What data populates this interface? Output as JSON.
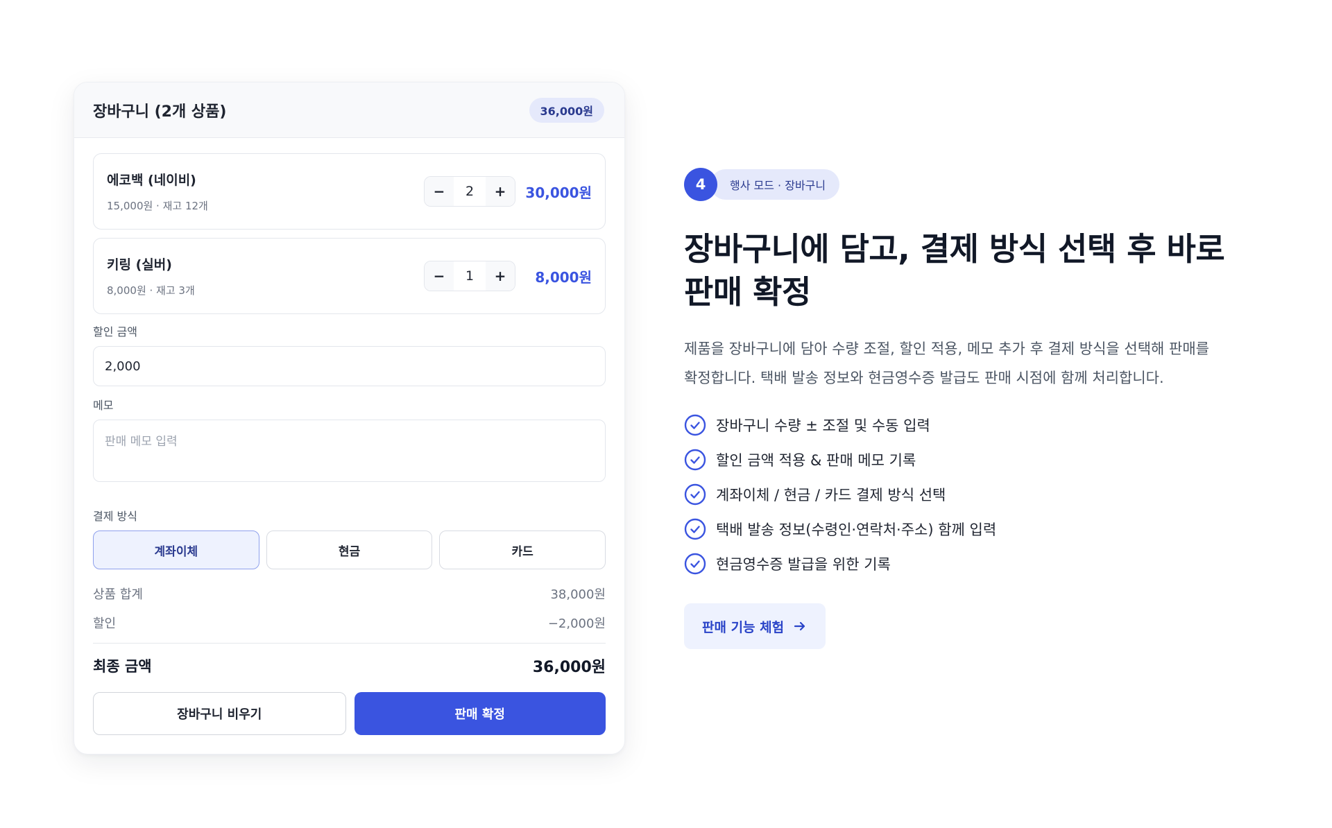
{
  "cart": {
    "title": "장바구니 (2개 상품)",
    "total_badge": "36,000원",
    "items": [
      {
        "name": "에코백 (네이비)",
        "meta": "15,000원 · 재고 12개",
        "quantity": "2",
        "price": "30,000원"
      },
      {
        "name": "키링 (실버)",
        "meta": "8,000원 · 재고 3개",
        "quantity": "1",
        "price": "8,000원"
      }
    ],
    "stepper": {
      "minus": "−",
      "plus": "+"
    },
    "discount": {
      "label": "할인 금액",
      "value": "2,000"
    },
    "memo": {
      "label": "메모",
      "placeholder": "판매 메모 입력"
    },
    "payment": {
      "label": "결제 방식",
      "options": [
        "계좌이체",
        "현금",
        "카드"
      ],
      "selected": "계좌이체"
    },
    "summary": {
      "subtotal_label": "상품 합계",
      "subtotal_value": "38,000원",
      "discount_label": "할인",
      "discount_value": "−2,000원",
      "final_label": "최종 금액",
      "final_value": "36,000원"
    },
    "actions": {
      "clear": "장바구니 비우기",
      "confirm": "판매 확정"
    }
  },
  "info": {
    "step_number": "4",
    "step_label": "행사 모드 · 장바구니",
    "headline": "장바구니에 담고, 결제 방식 선택 후 바로 판매 확정",
    "description": "제품을 장바구니에 담아 수량 조절, 할인 적용, 메모 추가 후 결제 방식을 선택해 판매를 확정합니다. 택배 발송 정보와 현금영수증 발급도 판매 시점에 함께 처리합니다.",
    "features": [
      "장바구니 수량 ± 조절 및 수동 입력",
      "할인 금액 적용 & 판매 메모 기록",
      "계좌이체 / 현금 / 카드 결제 방식 선택",
      "택배 발송 정보(수령인·연락처·주소) 함께 입력",
      "현금영수증 발급을 위한 기록"
    ],
    "cta_label": "판매 기능 체험"
  },
  "colors": {
    "accent": "#3a54e0",
    "accent_soft": "#e5e9fb",
    "text_primary": "#111827",
    "text_muted": "#6b7280"
  },
  "icons": {
    "feature_check": "check-circle-icon",
    "cta_arrow": "arrow-right-icon"
  }
}
